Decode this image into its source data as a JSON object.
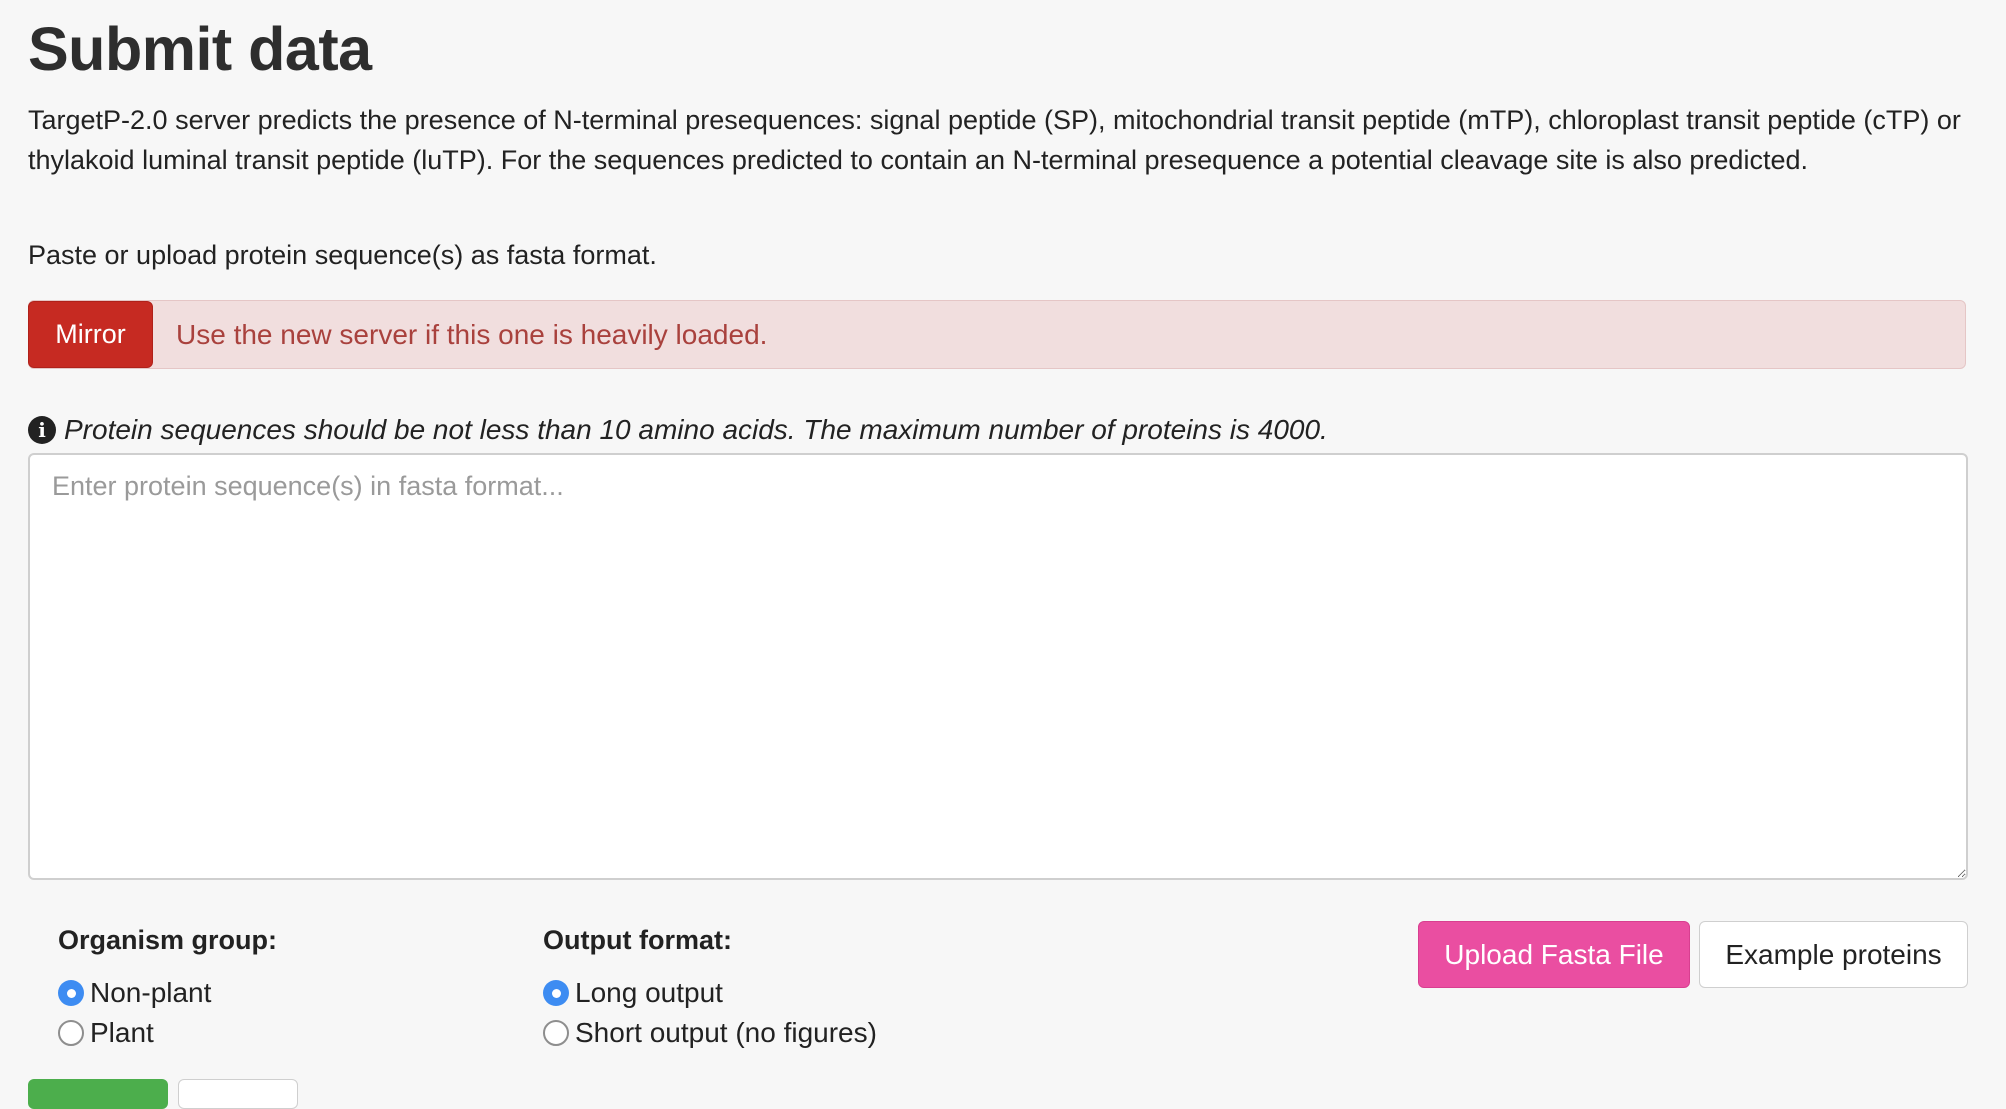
{
  "header": {
    "title": "Submit data"
  },
  "intro": {
    "description": "TargetP-2.0 server predicts the presence of N-terminal presequences: signal peptide (SP), mitochondrial transit peptide (mTP), chloroplast transit peptide (cTP) or thylakoid luminal transit peptide (luTP). For the sequences predicted to contain an N-terminal presequence a potential cleavage site is also predicted.",
    "instruction": "Paste or upload protein sequence(s) as fasta format."
  },
  "alert": {
    "button_label": "Mirror",
    "message": "Use the new server if this one is heavily loaded.",
    "button_color": "#c62a22",
    "background_color": "#f1dede"
  },
  "note": {
    "icon": "info-circle-icon",
    "text": "Protein sequences should be not less than 10 amino acids. The maximum number of proteins is 4000."
  },
  "sequence_input": {
    "value": "",
    "placeholder": "Enter protein sequence(s) in fasta format..."
  },
  "organism_group": {
    "title": "Organism group:",
    "options": [
      {
        "label": "Non-plant",
        "checked": true
      },
      {
        "label": "Plant",
        "checked": false
      }
    ]
  },
  "output_format": {
    "title": "Output format:",
    "options": [
      {
        "label": "Long output",
        "checked": true
      },
      {
        "label": "Short output (no figures)",
        "checked": false
      }
    ]
  },
  "actions": {
    "upload_label": "Upload Fasta File",
    "example_label": "Example proteins",
    "upload_color": "#ea4ea1",
    "radio_checked_color": "#3d8cf2"
  }
}
